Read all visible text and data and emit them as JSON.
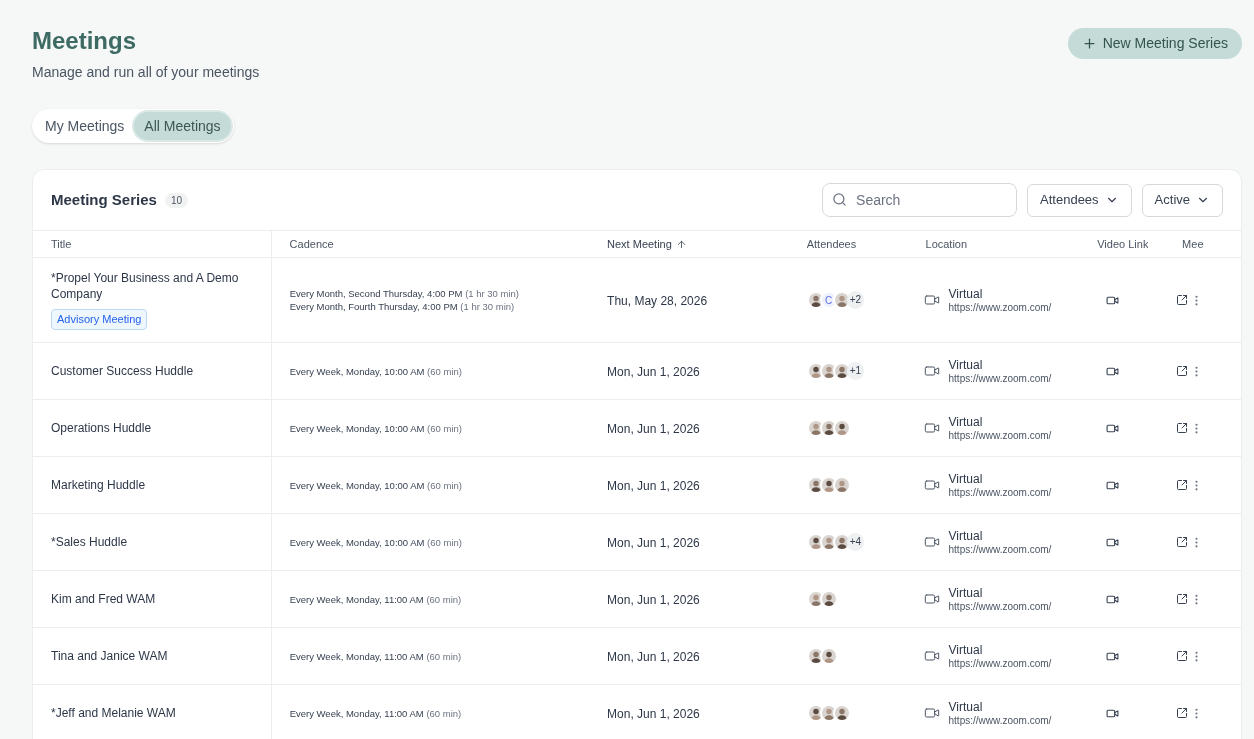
{
  "header": {
    "title": "Meetings",
    "subtitle": "Manage and run all of your meetings",
    "new_button": "New Meeting Series"
  },
  "tabs": [
    {
      "label": "My Meetings",
      "selected": false
    },
    {
      "label": "All Meetings",
      "selected": true
    }
  ],
  "panel": {
    "title": "Meeting Series",
    "count": "10",
    "search": {
      "placeholder": "Search"
    },
    "filters": [
      "Attendees",
      "Active"
    ]
  },
  "table": {
    "columns": [
      {
        "label": "Title",
        "sorted": false
      },
      {
        "label": "Cadence",
        "sorted": false
      },
      {
        "label": "Next Meeting",
        "sorted": true
      },
      {
        "label": "Attendees",
        "sorted": false
      },
      {
        "label": "Location",
        "sorted": false
      },
      {
        "label": "Video Link",
        "sorted": false
      },
      {
        "label": "Mee",
        "sorted": false
      }
    ],
    "rows": [
      {
        "title": "*Propel Your Business and A Demo Company",
        "tag": "Advisory Meeting",
        "cadence": [
          {
            "text": "Every Month, Second Thursday, 4:00 PM",
            "duration": "(1 hr 30 min)"
          },
          {
            "text": "Every Month, Fourth Thursday, 4:00 PM",
            "duration": "(1 hr 30 min)"
          }
        ],
        "next": "Thu, May 28, 2026",
        "attendees": [
          {
            "kind": "photo"
          },
          {
            "kind": "initial",
            "text": "C"
          },
          {
            "kind": "photo"
          }
        ],
        "more": "+2",
        "location": "Virtual",
        "url": "https://www.zoom.com/"
      },
      {
        "title": "Customer Success Huddle",
        "cadence": [
          {
            "text": "Every Week, Monday, 10:00 AM",
            "duration": "(60 min)"
          }
        ],
        "next": "Mon, Jun 1, 2026",
        "attendees": [
          {
            "kind": "photo"
          },
          {
            "kind": "photo"
          },
          {
            "kind": "photo"
          }
        ],
        "more": "+1",
        "location": "Virtual",
        "url": "https://www.zoom.com/"
      },
      {
        "title": "Operations Huddle",
        "cadence": [
          {
            "text": "Every Week, Monday, 10:00 AM",
            "duration": "(60 min)"
          }
        ],
        "next": "Mon, Jun 1, 2026",
        "attendees": [
          {
            "kind": "photo"
          },
          {
            "kind": "photo"
          },
          {
            "kind": "photo"
          }
        ],
        "location": "Virtual",
        "url": "https://www.zoom.com/"
      },
      {
        "title": "Marketing Huddle",
        "cadence": [
          {
            "text": "Every Week, Monday, 10:00 AM",
            "duration": "(60 min)"
          }
        ],
        "next": "Mon, Jun 1, 2026",
        "attendees": [
          {
            "kind": "photo"
          },
          {
            "kind": "photo"
          },
          {
            "kind": "photo"
          }
        ],
        "location": "Virtual",
        "url": "https://www.zoom.com/"
      },
      {
        "title": "*Sales Huddle",
        "cadence": [
          {
            "text": "Every Week, Monday, 10:00 AM",
            "duration": "(60 min)"
          }
        ],
        "next": "Mon, Jun 1, 2026",
        "attendees": [
          {
            "kind": "photo"
          },
          {
            "kind": "photo"
          },
          {
            "kind": "photo"
          }
        ],
        "more": "+4",
        "location": "Virtual",
        "url": "https://www.zoom.com/"
      },
      {
        "title": "Kim and Fred WAM",
        "cadence": [
          {
            "text": "Every Week, Monday, 11:00 AM",
            "duration": "(60 min)"
          }
        ],
        "next": "Mon, Jun 1, 2026",
        "attendees": [
          {
            "kind": "photo"
          },
          {
            "kind": "photo"
          }
        ],
        "location": "Virtual",
        "url": "https://www.zoom.com/"
      },
      {
        "title": "Tina and Janice WAM",
        "cadence": [
          {
            "text": "Every Week, Monday, 11:00 AM",
            "duration": "(60 min)"
          }
        ],
        "next": "Mon, Jun 1, 2026",
        "attendees": [
          {
            "kind": "photo"
          },
          {
            "kind": "photo"
          }
        ],
        "location": "Virtual",
        "url": "https://www.zoom.com/"
      },
      {
        "title": "*Jeff and Melanie WAM",
        "cadence": [
          {
            "text": "Every Week, Monday, 11:00 AM",
            "duration": "(60 min)"
          }
        ],
        "next": "Mon, Jun 1, 2026",
        "attendees": [
          {
            "kind": "photo"
          },
          {
            "kind": "photo"
          },
          {
            "kind": "photo"
          }
        ],
        "location": "Virtual",
        "url": "https://www.zoom.com/"
      }
    ]
  }
}
